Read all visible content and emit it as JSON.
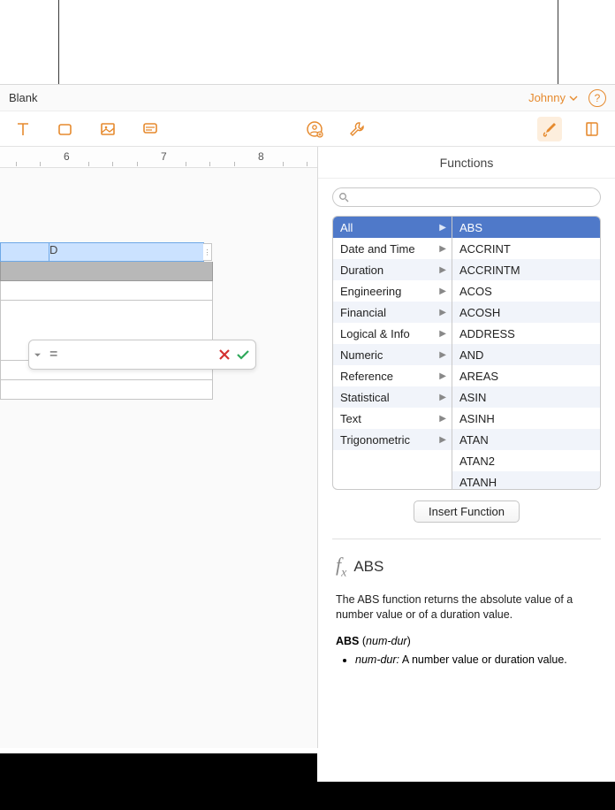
{
  "title": "Blank",
  "user": "Johnny",
  "ruler": {
    "ticks": [
      "6",
      "7",
      "8"
    ]
  },
  "table": {
    "col_label": "D"
  },
  "formula": {
    "content": "="
  },
  "panel": {
    "title": "Functions",
    "search_placeholder": "",
    "categories": [
      "All",
      "Date and Time",
      "Duration",
      "Engineering",
      "Financial",
      "Logical & Info",
      "Numeric",
      "Reference",
      "Statistical",
      "Text",
      "Trigonometric"
    ],
    "selected_category": "All",
    "functions": [
      "ABS",
      "ACCRINT",
      "ACCRINTM",
      "ACOS",
      "ACOSH",
      "ADDRESS",
      "AND",
      "AREAS",
      "ASIN",
      "ASINH",
      "ATAN",
      "ATAN2",
      "ATANH"
    ],
    "selected_function": "ABS",
    "insert_label": "Insert Function"
  },
  "doc": {
    "name": "ABS",
    "description": "The ABS function returns the absolute value of a number value or of a duration value.",
    "signature_fn": "ABS",
    "signature_arg": "num-dur",
    "arg_name": "num-dur:",
    "arg_desc": "A number value or duration value."
  }
}
